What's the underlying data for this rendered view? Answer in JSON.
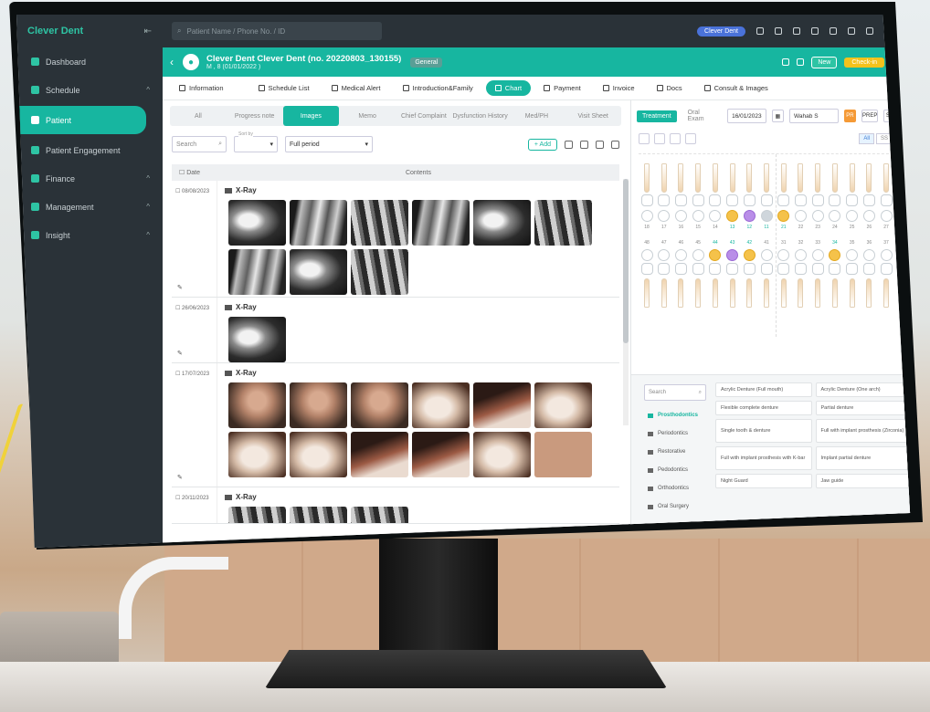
{
  "sidebar": {
    "logo": "Clever Dent",
    "collapse_icon": "collapse-icon",
    "items": [
      {
        "label": "Dashboard",
        "chevron": ""
      },
      {
        "label": "Schedule",
        "chevron": "^"
      },
      {
        "label": "Patient",
        "chevron": ""
      },
      {
        "label": "Patient Engagement",
        "chevron": ""
      },
      {
        "label": "Finance",
        "chevron": "^"
      },
      {
        "label": "Management",
        "chevron": "^"
      },
      {
        "label": "Insight",
        "chevron": "^"
      }
    ]
  },
  "topbar": {
    "search_placeholder": "Patient Name / Phone No. / ID",
    "pill": "Clever Dent"
  },
  "patient": {
    "name": "Clever Dent Clever Dent (no. 20220803_130155)",
    "sub": "M , 8 (01/01/2022 )",
    "badge": "General",
    "new_btn": "New",
    "checkin_btn": "Check-in"
  },
  "tabs": [
    "Information",
    "Schedule List",
    "Medical Alert",
    "Introduction&Family",
    "Chart",
    "Payment",
    "Invoice",
    "Docs",
    "Consult & Images"
  ],
  "subtabs": [
    "All",
    "Progress note",
    "Images",
    "Memo",
    "Chief Complaint",
    "Dysfunction History",
    "Med/PH",
    "Visit Sheet"
  ],
  "filters": {
    "search_placeholder": "Search",
    "sort_label": "Sort by",
    "period": "Full period",
    "add_label": "+ Add"
  },
  "table": {
    "col_date": "Date",
    "col_contents": "Contents"
  },
  "groups": [
    {
      "date": "08/08/2023",
      "title": "X-Ray",
      "thumbs": [
        "xray",
        "xray2",
        "xray3",
        "xray2",
        "xray",
        "xray3",
        "xray2",
        "xray",
        "xray3"
      ]
    },
    {
      "date": "26/06/2023",
      "title": "X-Ray",
      "thumbs": [
        "xray"
      ]
    },
    {
      "date": "17/07/2023",
      "title": "X-Ray",
      "thumbs": [
        "photo1",
        "photo1",
        "photo1",
        "photo2",
        "photo3",
        "photo2",
        "photo2",
        "photo2",
        "photo3",
        "photo3",
        "photo2",
        "photo4"
      ]
    },
    {
      "date": "20/11/2023",
      "title": "X-Ray",
      "thumbs": [
        "xray3",
        "xray3",
        "xray3"
      ]
    }
  ],
  "right": {
    "tab_treatment": "Treatment",
    "tab_oral": "Oral Exam",
    "date": "16/01/2023",
    "doctor_label": "Doctor",
    "doctor": "Wahab S",
    "btn_pr": "PR",
    "btn_prep": "PREP",
    "btn_sp": "SP",
    "btn_c": "C",
    "seg": [
      "All",
      "SS",
      "Cst"
    ]
  },
  "teeth_upper": [
    "18",
    "17",
    "16",
    "15",
    "14",
    "13",
    "12",
    "11",
    "21",
    "22",
    "23",
    "24",
    "25",
    "26",
    "27",
    "28"
  ],
  "teeth_lower": [
    "48",
    "47",
    "46",
    "45",
    "44",
    "43",
    "42",
    "41",
    "31",
    "32",
    "33",
    "34",
    "35",
    "36",
    "37",
    "38"
  ],
  "upper_marks": [
    "",
    "",
    "",
    "",
    "",
    "y",
    "p",
    "g",
    "y",
    "",
    "",
    "",
    "",
    "",
    "",
    ""
  ],
  "lower_marks": [
    "",
    "",
    "",
    "",
    "y",
    "p",
    "y",
    "",
    "",
    "",
    "",
    "y",
    "",
    "",
    "",
    ""
  ],
  "categories": {
    "search_placeholder": "Search",
    "items": [
      "Prosthodontics",
      "Periodontics",
      "Restorative",
      "Pedodontics",
      "Orthodontics",
      "Oral Surgery"
    ]
  },
  "options": [
    "Acrylic Denture (Full mouth)",
    "Acrylic Denture (One arch)",
    "Flexible complete denture",
    "Partial denture",
    "Single tooth & denture",
    "Full with implant prosthesis (Zirconia)",
    "Full with implant prosthesis with K-bar",
    "Implant partial denture",
    "Night Guard",
    "Jaw guide"
  ]
}
